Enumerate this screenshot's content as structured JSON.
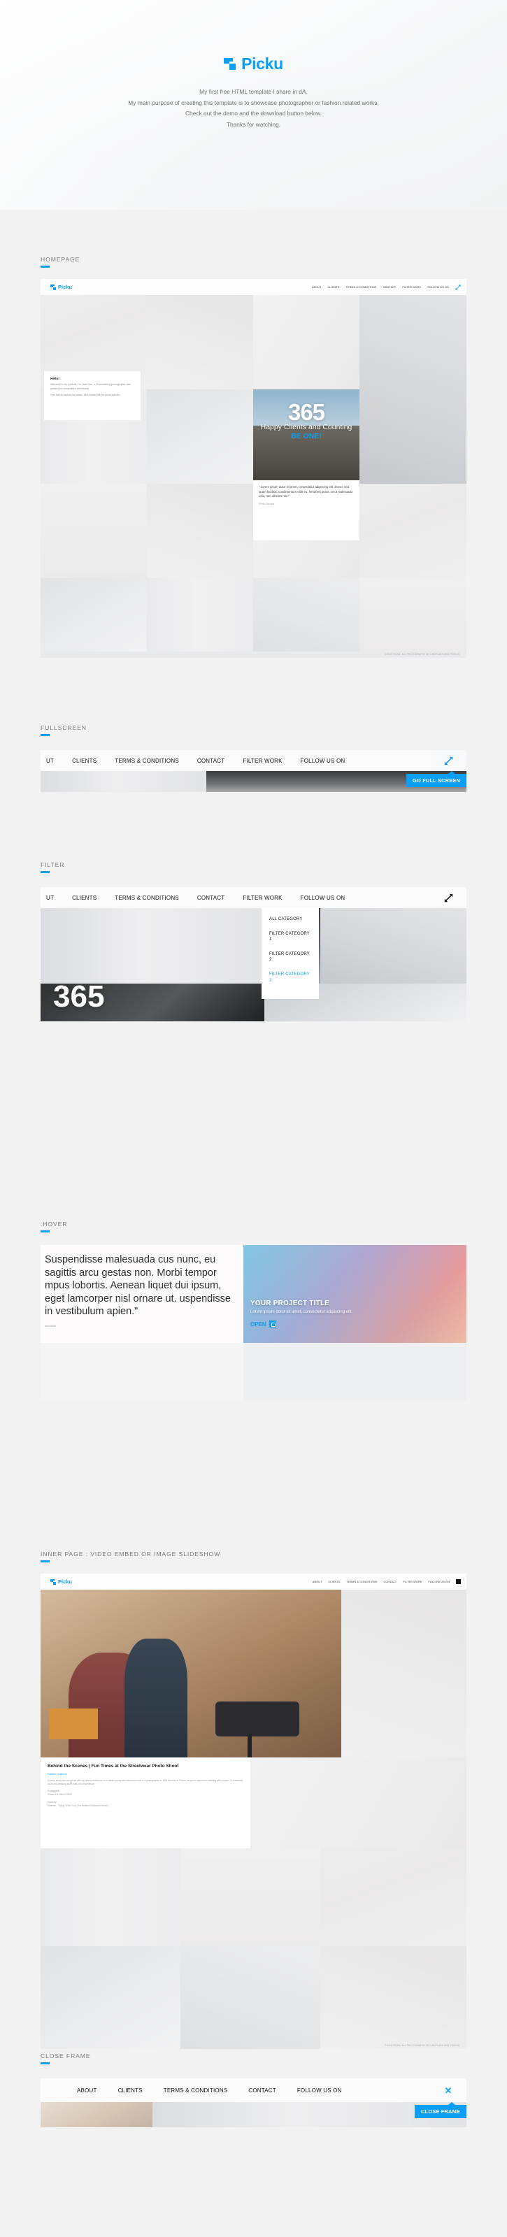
{
  "brand": {
    "name": "Picku",
    "accent": "#0a9ef4",
    "icon": "pixel-squares-logo"
  },
  "intro": {
    "lines": [
      "My first free HTML template I share in dA.",
      "My main purpose of creating this template is to showcase photographer or fashion related works.",
      "Check out the demo and the download button below.",
      "Thanks for watching."
    ]
  },
  "sections": [
    {
      "id": "homepage",
      "label": "HOMEPAGE"
    },
    {
      "id": "fullscreen",
      "label": "FULLSCREEN"
    },
    {
      "id": "filter",
      "label": "FILTER"
    },
    {
      "id": "hover",
      "label": ":HOVER"
    },
    {
      "id": "innerpage",
      "label": "INNER PAGE : VIDEO EMBED OR IMAGE SLIDESHOW"
    },
    {
      "id": "closeframe",
      "label": "CLOSE FRAME"
    }
  ],
  "nav": {
    "items": [
      "ABOUT",
      "CLIENTS",
      "TERMS & CONDITIONS",
      "CONTACT",
      "FILTER WORK",
      "FOLLOW US ON"
    ],
    "items_truncated": [
      "UT",
      "CLIENTS",
      "TERMS & CONDITIONS",
      "CONTACT",
      "FILTER WORK",
      "FOLLOW US ON"
    ],
    "expand_icon": "expand-arrows-icon"
  },
  "homepage": {
    "hero": {
      "number": "365",
      "line1": "Happy Clients and Counting",
      "line2": "BE ONE!"
    },
    "quote": {
      "text": "\" Lorem ipsum dolor sit amet, consectetur adipiscing elit. Donec sed quam facilisis, condimentum nibh eu, hendrerit purus. Ut ut malesuada odio, nec ultricies nisi \"",
      "source": "Photo Review"
    },
    "hello": {
      "title": "Hello!",
      "p1": "Welcome to my portfolio, I'm Jane Doe, a 20-something photographer with passion for composition and beauty.",
      "p2": "Feel free to explore my works. And contact me for photo queries."
    },
    "footer_credit": "©2015 PICKU. ALL PHOTOGRAPHY BY UNSPLASH AND PEXELS"
  },
  "fullscreen": {
    "tooltip": "GO FULL SCREEN"
  },
  "filter": {
    "options": [
      {
        "label": "ALL CATEGORY",
        "active": false
      },
      {
        "label": "FILTER CATEGORY 1",
        "active": false
      },
      {
        "label": "FILTER CATEGORY 2",
        "active": false
      },
      {
        "label": "FILTER CATEGORY 3",
        "active": true
      }
    ],
    "big_number": "365"
  },
  "hover": {
    "paragraph": "Suspendisse malesuada cus nunc, eu sagittis arcu gestas non. Morbi tempor mpus lobortis. Aenean liquet dui ipsum, eget lamcorper nisl ornare ut. uspendisse in vestibulum apien.\"",
    "small": "nsectetur",
    "card": {
      "title": "YOUR PROJECT TITLE",
      "subtitle": "Lorem ipsum dolor sit amet, consectetur adipiscing elit.",
      "cta": "OPEN",
      "cta_icon": "open-frame-icon"
    }
  },
  "innerpage": {
    "article": {
      "title": "Behind the Scenes | Fun Times at the Streetwear Photo Shoot",
      "category": "Fashion Lookbook",
      "body": "A photo shoot was conceived with my friends that focus on a classic young and vivacious mood in a photographic in. With the help of Pexels, we got to capture her wearing with a tripod. The absurdly polite and amazing and it was a fun experience!",
      "meta1": "Photograph:",
      "meta2": "iPhone 6 & Nikon D3200",
      "meta3": "Music by:",
      "meta4": "Modena - \"Trying To Be Cool (The Whitest Drunkard's Remix)\""
    },
    "footer_credit": "©2015 PICKU. ALL PHOTOGRAPHY BY UNSPLASH AND PEXELS"
  },
  "closeframe": {
    "tooltip": "CLOSE FRAME",
    "close_icon": "close-x-icon"
  }
}
